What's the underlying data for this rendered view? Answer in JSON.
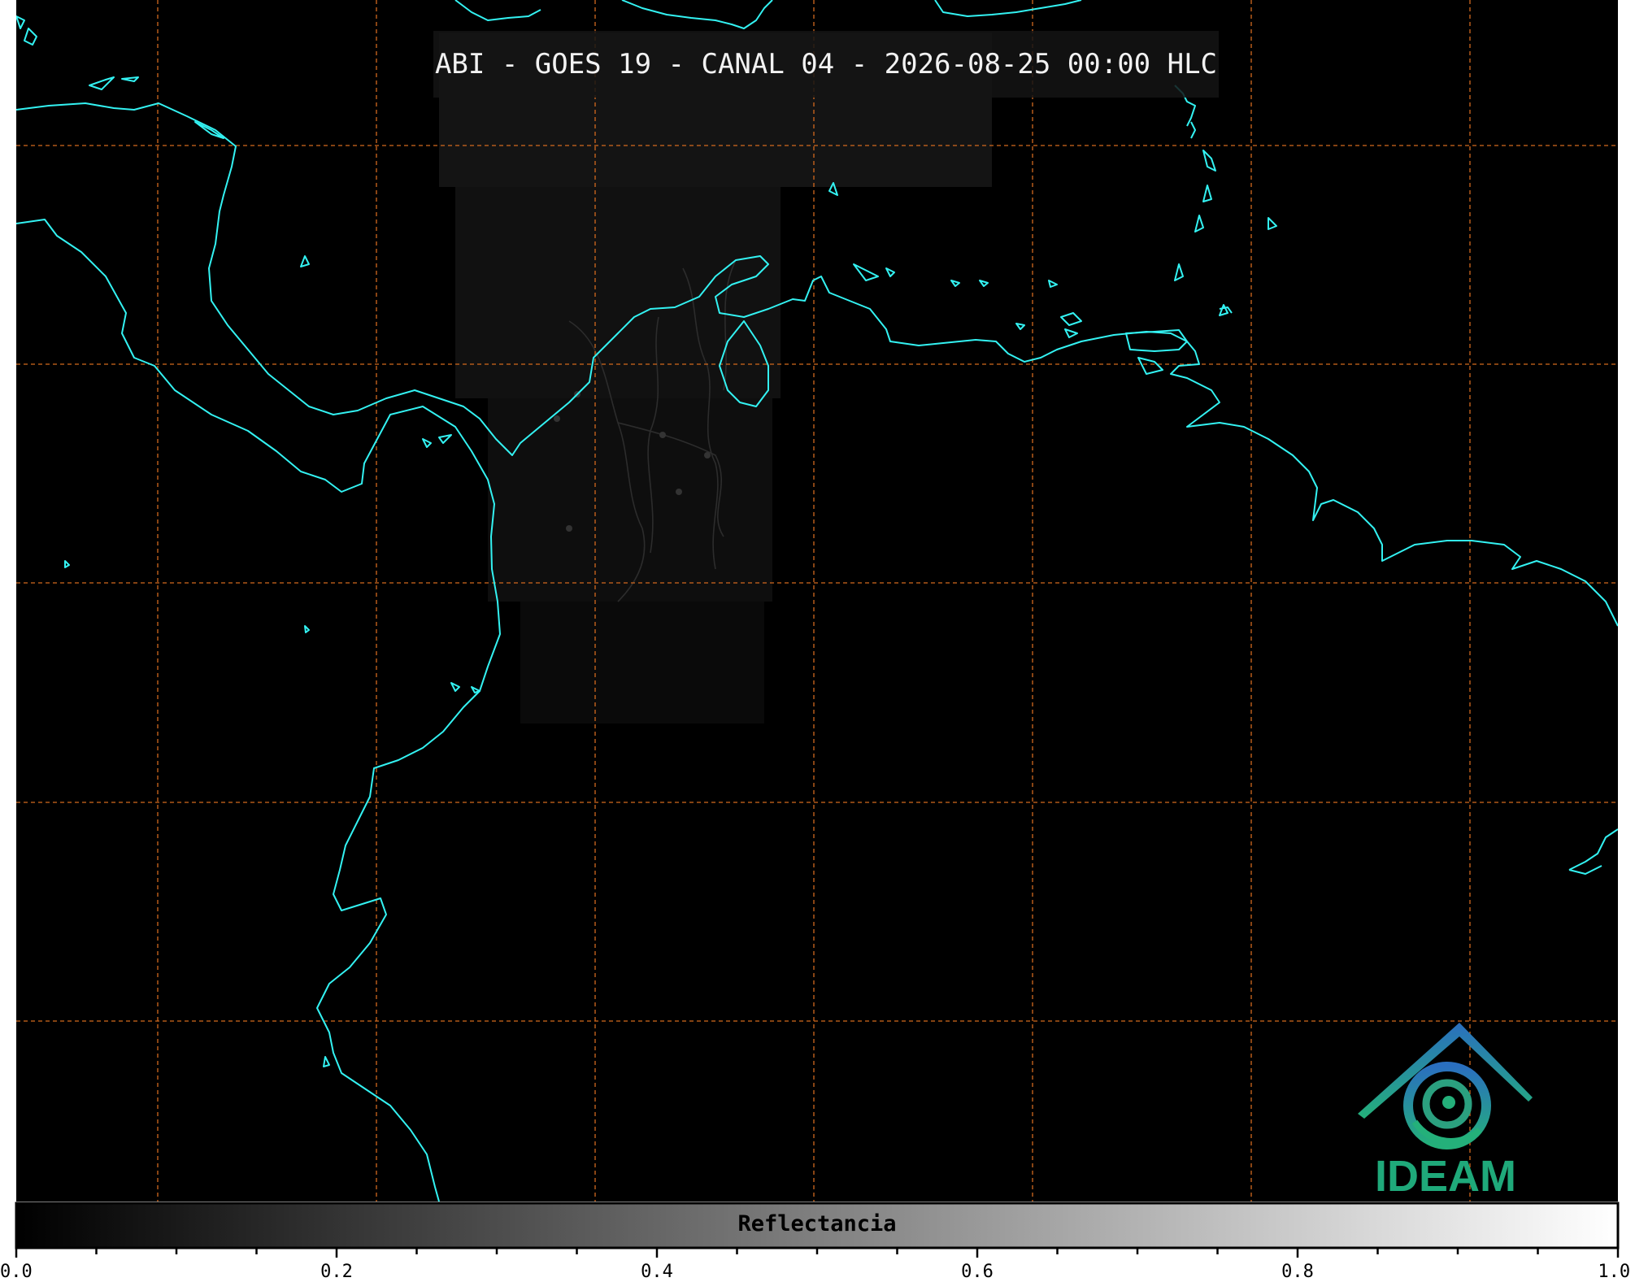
{
  "title": "ABI - GOES 19 - CANAL 04 - 2026-08-25 00:00 HLC",
  "colorbar": {
    "label": "Reflectancia",
    "min": 0.0,
    "max": 1.0,
    "tick_labels": [
      "0.0",
      "0.2",
      "0.4",
      "0.6",
      "0.8",
      "1.0"
    ],
    "minor_tick_step": 0.05
  },
  "logo": {
    "text": "IDEAM",
    "color": "#1fa97a",
    "icon": "ideam-spiral-mountain-logo"
  },
  "colors": {
    "background": "#000000",
    "coastline": "#33f2f2",
    "gridline": "#d2691e",
    "borders": "#2a2a2a"
  }
}
